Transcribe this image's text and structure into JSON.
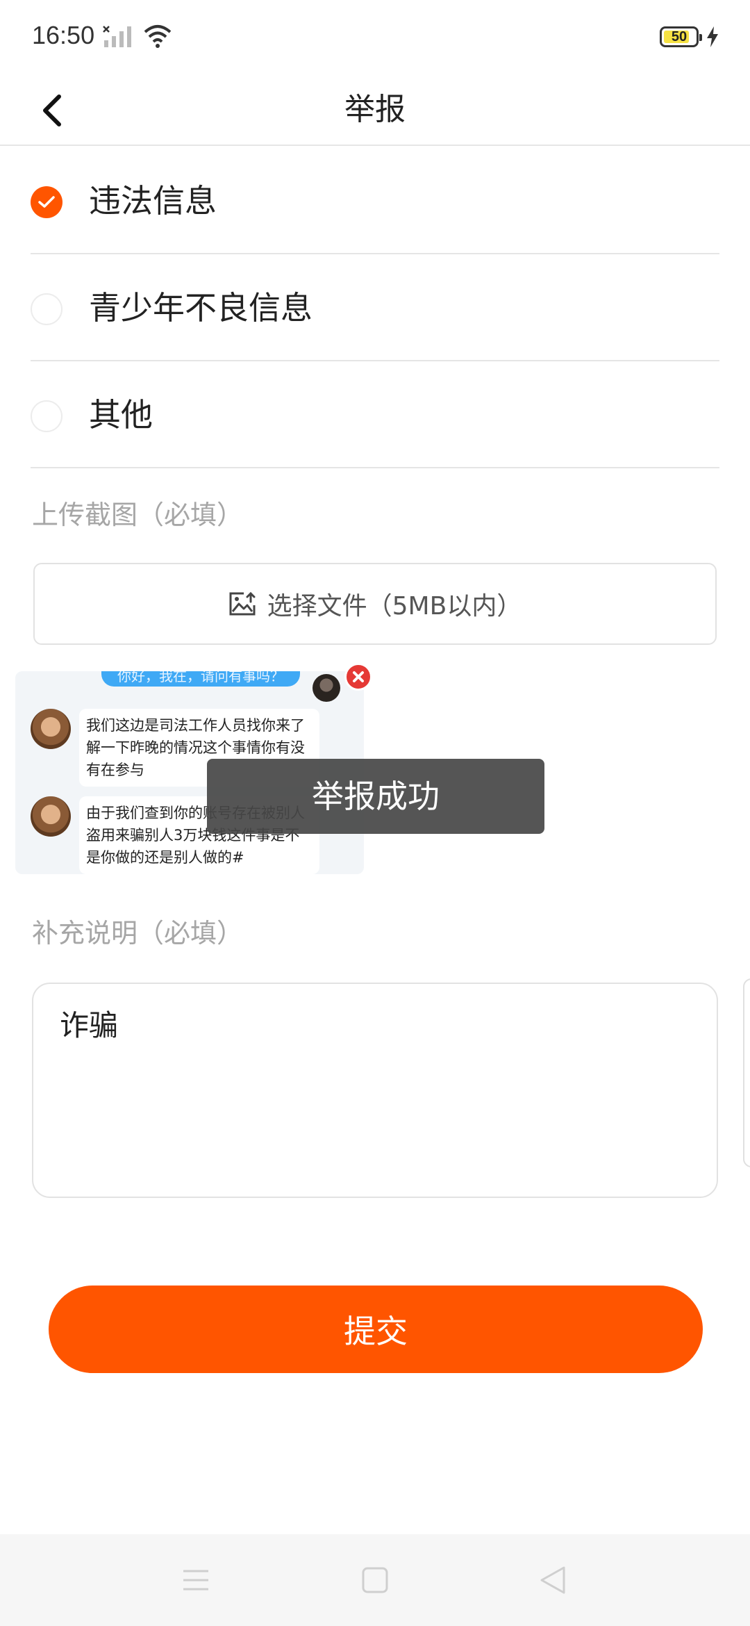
{
  "status_bar": {
    "time": "16:50",
    "battery": "50"
  },
  "header": {
    "title": "举报"
  },
  "options": [
    {
      "label": "违法信息",
      "checked": true
    },
    {
      "label": "青少年不良信息",
      "checked": false
    },
    {
      "label": "其他",
      "checked": false
    }
  ],
  "upload": {
    "section_label": "上传截图（必填）",
    "picker_label": "选择文件（5MB以内）",
    "screenshot": {
      "top_bubble": "你好，我在，请问有事吗？",
      "messages": [
        "我们这边是司法工作人员找你来了解一下昨晚的情况这个事情你有没有在参与",
        "由于我们查到你的账号存在被别人盗用来骗别人3万块钱这件事是不是你做的还是别人做的#"
      ]
    }
  },
  "toast": {
    "text": "举报成功"
  },
  "description": {
    "section_label": "补充说明（必填）",
    "value": "诈骗"
  },
  "submit": {
    "label": "提交"
  },
  "colors": {
    "accent": "#ff5500",
    "label_gray": "#a6a6a6"
  }
}
